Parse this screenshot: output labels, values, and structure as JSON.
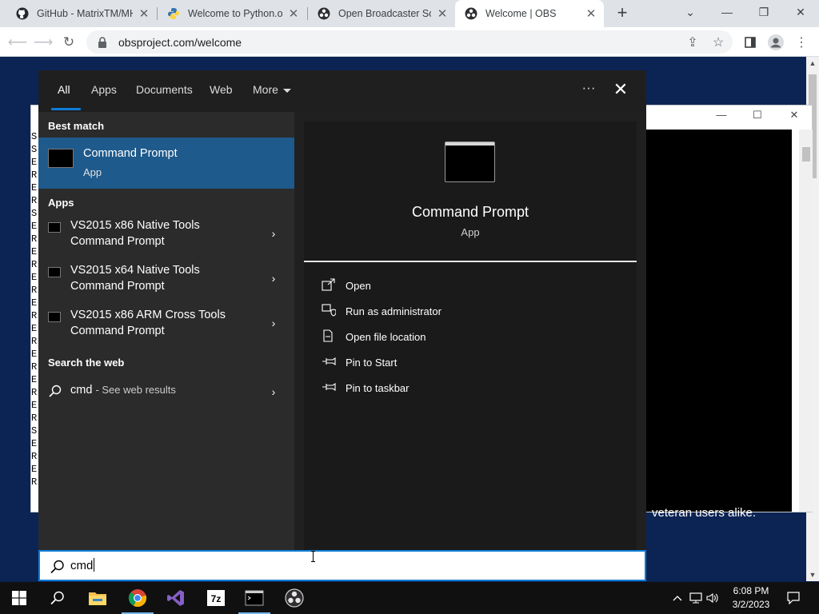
{
  "browser": {
    "tabs": [
      {
        "title": "GitHub - MatrixTM/MH",
        "icon": "github-icon"
      },
      {
        "title": "Welcome to Python.org",
        "icon": "python-icon"
      },
      {
        "title": "Open Broadcaster Softw",
        "icon": "obs-icon"
      },
      {
        "title": "Welcome | OBS",
        "icon": "obs-icon",
        "active": true
      }
    ],
    "new_tab": "+",
    "window_controls": {
      "dropdown": "⌄",
      "minimize": "—",
      "restore": "❐",
      "close": "✕"
    },
    "url": "obsproject.com/welcome"
  },
  "background_window": {
    "left_letters": [
      "S",
      "S",
      "E",
      "R",
      "E",
      "R",
      "S",
      "E",
      "R",
      "E",
      "R",
      "E",
      "R",
      "E",
      "R",
      "E",
      "R",
      "E",
      "R",
      "E",
      "R",
      "E",
      "R",
      "S",
      "E",
      "R",
      "E",
      "R"
    ],
    "page_text": "veteran users alike."
  },
  "search": {
    "tabs": [
      "All",
      "Apps",
      "Documents",
      "Web",
      "More"
    ],
    "best_match_heading": "Best match",
    "best_match": {
      "name": "Command Prompt",
      "kind": "App"
    },
    "apps_heading": "Apps",
    "apps": [
      {
        "line1": "VS2015 x86 Native Tools",
        "line2": "Command Prompt"
      },
      {
        "line1": "VS2015 x64 Native Tools",
        "line2": "Command Prompt"
      },
      {
        "line1": "VS2015 x86 ARM Cross Tools",
        "line2": "Command Prompt"
      }
    ],
    "web_heading": "Search the web",
    "web_query": "cmd",
    "web_suffix": "- See web results",
    "preview": {
      "name": "Command Prompt",
      "kind": "App"
    },
    "actions": [
      {
        "label": "Open",
        "icon": "open-icon"
      },
      {
        "label": "Run as administrator",
        "icon": "shield-admin-icon"
      },
      {
        "label": "Open file location",
        "icon": "file-location-icon"
      },
      {
        "label": "Pin to Start",
        "icon": "pin-icon"
      },
      {
        "label": "Pin to taskbar",
        "icon": "pin-icon"
      }
    ],
    "input_value": "cmd"
  },
  "taskbar": {
    "apps": [
      "start-icon",
      "search-icon",
      "file-explorer-icon",
      "chrome-icon",
      "visual-studio-icon",
      "7zip-icon",
      "cmd-icon",
      "obs-icon"
    ],
    "time": "6:08 PM",
    "date": "3/2/2023"
  },
  "colors": {
    "accent": "#0f7dd7",
    "best_match_bg": "#1e5a8c",
    "panel_bg": "#202020",
    "web_bg": "#0c2454"
  }
}
